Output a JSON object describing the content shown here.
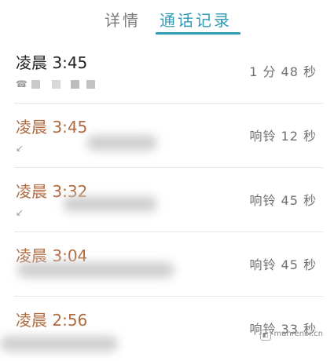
{
  "tabs": {
    "details_label": "详情",
    "calls_label": "通话记录",
    "active": "calls"
  },
  "calls": [
    {
      "time": "凌晨 3:45",
      "result": "1 分 48 秒",
      "missed": false
    },
    {
      "time": "凌晨 3:45",
      "result": "响铃 12 秒",
      "missed": true
    },
    {
      "time": "凌晨 3:32",
      "result": "响铃 45 秒",
      "missed": true
    },
    {
      "time": "凌晨 3:04",
      "result": "响铃 45 秒",
      "missed": true
    },
    {
      "time": "凌晨 2:56",
      "result": "响铃 33 秒",
      "missed": true
    }
  ],
  "colors": {
    "accent": "#2e9bb5",
    "missed_time": "#b06a3f",
    "normal_time": "#222222"
  },
  "icons": {
    "outgoing": "phone-icon",
    "missed": "missed-call-icon"
  },
  "watermark": {
    "text": "manrenoi.cn"
  }
}
